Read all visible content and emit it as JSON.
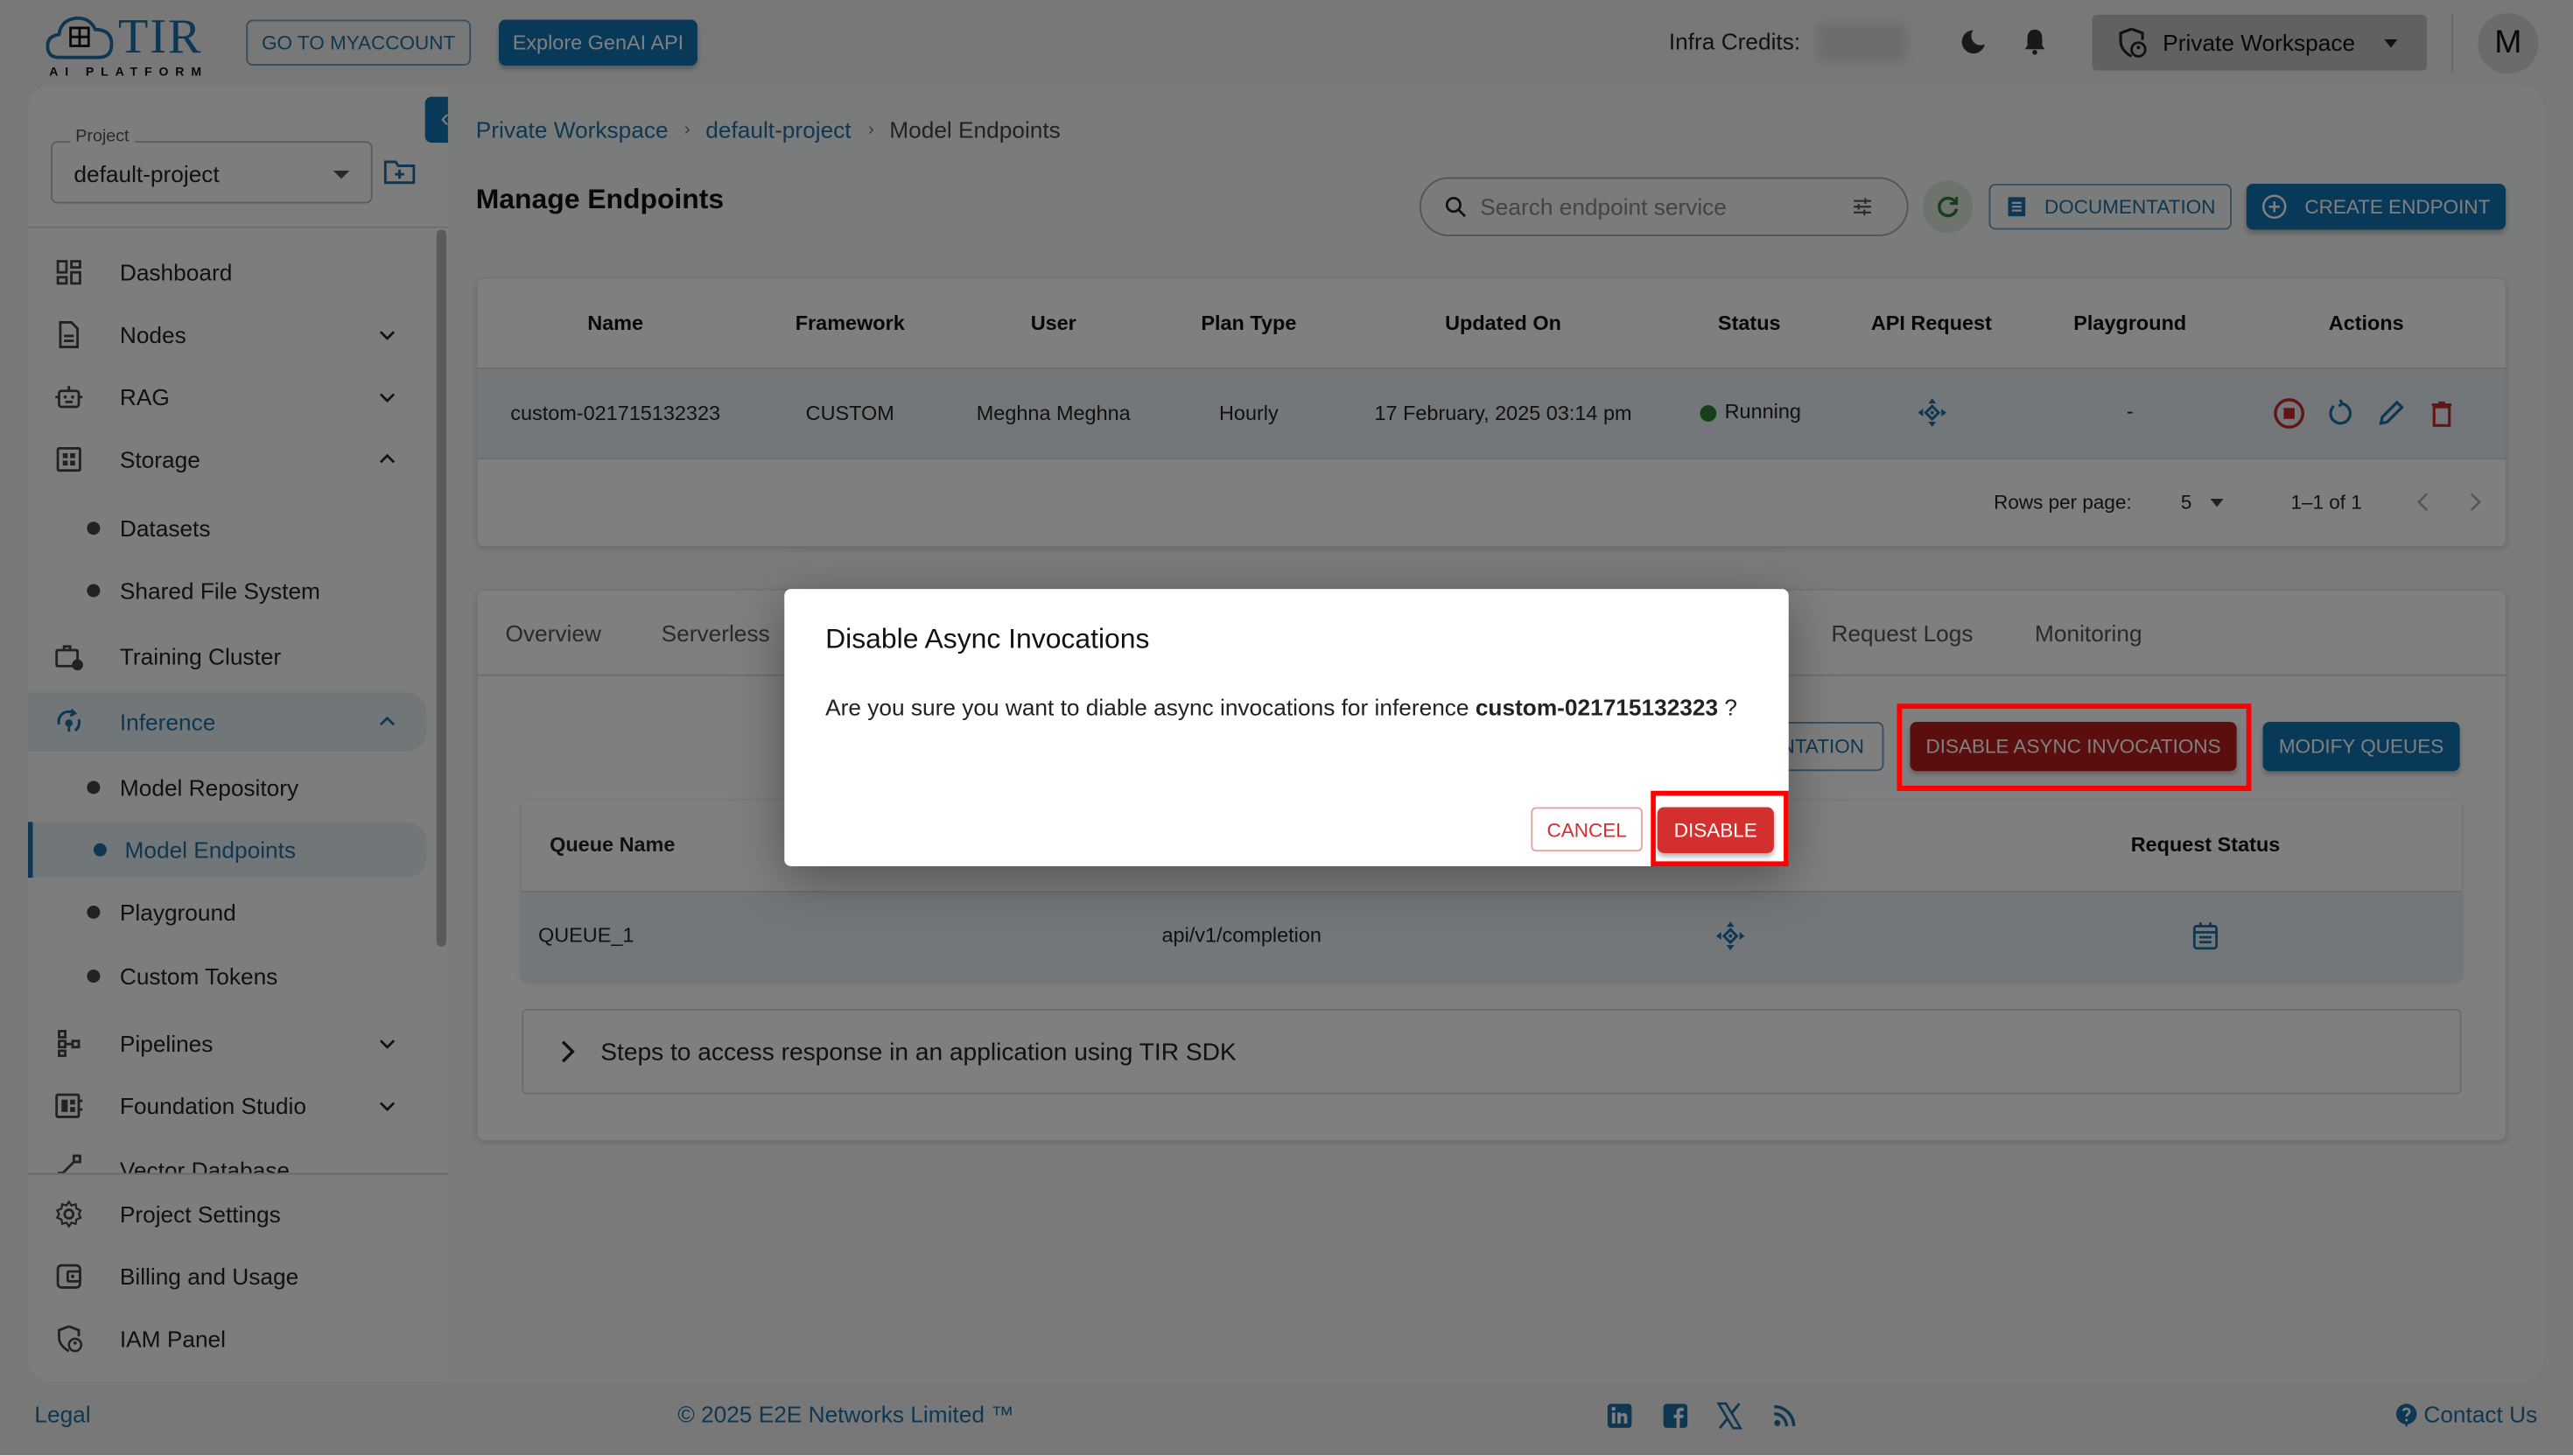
{
  "header": {
    "logo_text": "TIR",
    "logo_subtext": "AI PLATFORM",
    "go_to_myaccount": "GO TO MYACCOUNT",
    "explore_genai": "Explore GenAI API",
    "infra_credits_label": "Infra Credits:",
    "workspace_selector": "Private Workspace",
    "avatar_initial": "M"
  },
  "sidebar": {
    "project_label": "Project",
    "project_value": "default-project",
    "items": [
      {
        "label": "Dashboard",
        "icon": "dashboard-icon"
      },
      {
        "label": "Nodes",
        "icon": "nodes-icon",
        "expandable": "collapsed"
      },
      {
        "label": "RAG",
        "icon": "robot-icon",
        "expandable": "collapsed"
      },
      {
        "label": "Storage",
        "icon": "storage-icon",
        "expandable": "expanded"
      },
      {
        "label": "Datasets",
        "sub": true
      },
      {
        "label": "Shared File System",
        "sub": true
      },
      {
        "label": "Training Cluster",
        "icon": "training-cluster-icon"
      },
      {
        "label": "Inference",
        "icon": "inference-icon",
        "expandable": "expanded",
        "active_parent": true
      },
      {
        "label": "Model Repository",
        "sub": true
      },
      {
        "label": "Model Endpoints",
        "sub": true,
        "active": true
      },
      {
        "label": "Playground",
        "sub": true
      },
      {
        "label": "Custom Tokens",
        "sub": true
      },
      {
        "label": "Pipelines",
        "icon": "pipelines-icon",
        "expandable": "collapsed"
      },
      {
        "label": "Foundation Studio",
        "icon": "foundation-studio-icon",
        "expandable": "collapsed"
      },
      {
        "label": "Vector Database",
        "icon": "vector-database-icon"
      }
    ],
    "bottom_items": [
      {
        "label": "Project Settings",
        "icon": "gear-icon"
      },
      {
        "label": "Billing and Usage",
        "icon": "wallet-icon"
      },
      {
        "label": "IAM Panel",
        "icon": "iam-shield-icon"
      }
    ]
  },
  "breadcrumb": [
    "Private Workspace",
    "default-project",
    "Model Endpoints"
  ],
  "page_title": "Manage Endpoints",
  "toolbar": {
    "search_placeholder": "Search endpoint service",
    "documentation": "DOCUMENTATION",
    "create_endpoint": "CREATE ENDPOINT"
  },
  "endpoints_table": {
    "columns": [
      "Name",
      "Framework",
      "User",
      "Plan Type",
      "Updated On",
      "Status",
      "API Request",
      "Playground",
      "Actions"
    ],
    "rows": [
      {
        "name": "custom-021715132323",
        "framework": "CUSTOM",
        "user": "Meghna Meghna",
        "plan_type": "Hourly",
        "updated_on": "17 February, 2025 03:14 pm",
        "status": "Running",
        "playground": "-"
      }
    ],
    "rows_per_page_label": "Rows per page:",
    "rows_per_page": "5",
    "range": "1–1 of 1"
  },
  "detail_tabs": [
    "Overview",
    "Serverless",
    "Request Logs",
    "Monitoring"
  ],
  "async_panel": {
    "documentation_partial": "NTATION",
    "disable_async": "DISABLE ASYNC INVOCATIONS",
    "modify_queues": "MODIFY QUEUES",
    "queue_columns": [
      "Queue Name",
      "",
      "",
      "Request Status"
    ],
    "queue_rows": [
      {
        "name": "QUEUE_1",
        "path": "api/v1/completion"
      }
    ],
    "sdk_steps": "Steps to access response in an application using TIR SDK"
  },
  "dialog": {
    "title": "Disable Async Invocations",
    "message_prefix": "Are you sure you want to diable async invocations for inference",
    "message_target": "custom-021715132323",
    "message_suffix": "?",
    "cancel": "CANCEL",
    "confirm": "DISABLE"
  },
  "footer": {
    "legal": "Legal",
    "copyright": "© 2025 E2E Networks Limited ™",
    "contact": "Contact Us"
  },
  "colors": {
    "brand": "#1272b3",
    "danger": "#d32f2f",
    "success": "#2e7d32",
    "highlight": "#ff0000"
  }
}
